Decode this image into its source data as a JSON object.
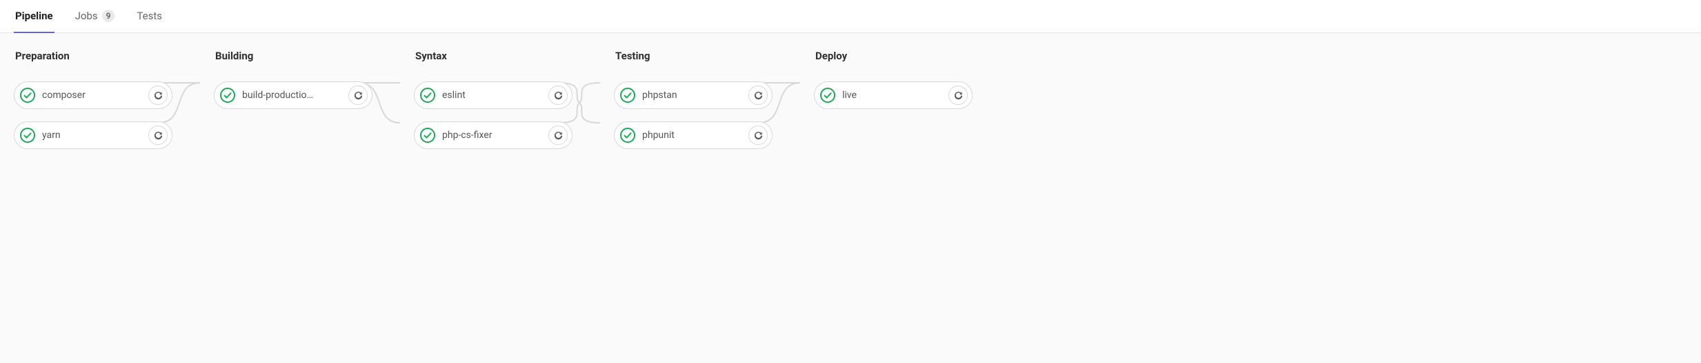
{
  "tabs": [
    {
      "label": "Pipeline",
      "active": true,
      "badge": null
    },
    {
      "label": "Jobs",
      "active": false,
      "badge": "9"
    },
    {
      "label": "Tests",
      "active": false,
      "badge": null
    }
  ],
  "colors": {
    "success": "#1aaa55",
    "retry_icon": "#5c5c5c",
    "connector": "#d8d8d8"
  },
  "stages": [
    {
      "title": "Preparation",
      "jobs": [
        {
          "name": "composer",
          "status": "success"
        },
        {
          "name": "yarn",
          "status": "success"
        }
      ]
    },
    {
      "title": "Building",
      "jobs": [
        {
          "name": "build-productio…",
          "status": "success"
        }
      ]
    },
    {
      "title": "Syntax",
      "jobs": [
        {
          "name": "eslint",
          "status": "success"
        },
        {
          "name": "php-cs-fixer",
          "status": "success"
        }
      ]
    },
    {
      "title": "Testing",
      "jobs": [
        {
          "name": "phpstan",
          "status": "success"
        },
        {
          "name": "phpunit",
          "status": "success"
        }
      ]
    },
    {
      "title": "Deploy",
      "jobs": [
        {
          "name": "live",
          "status": "success"
        }
      ]
    }
  ]
}
